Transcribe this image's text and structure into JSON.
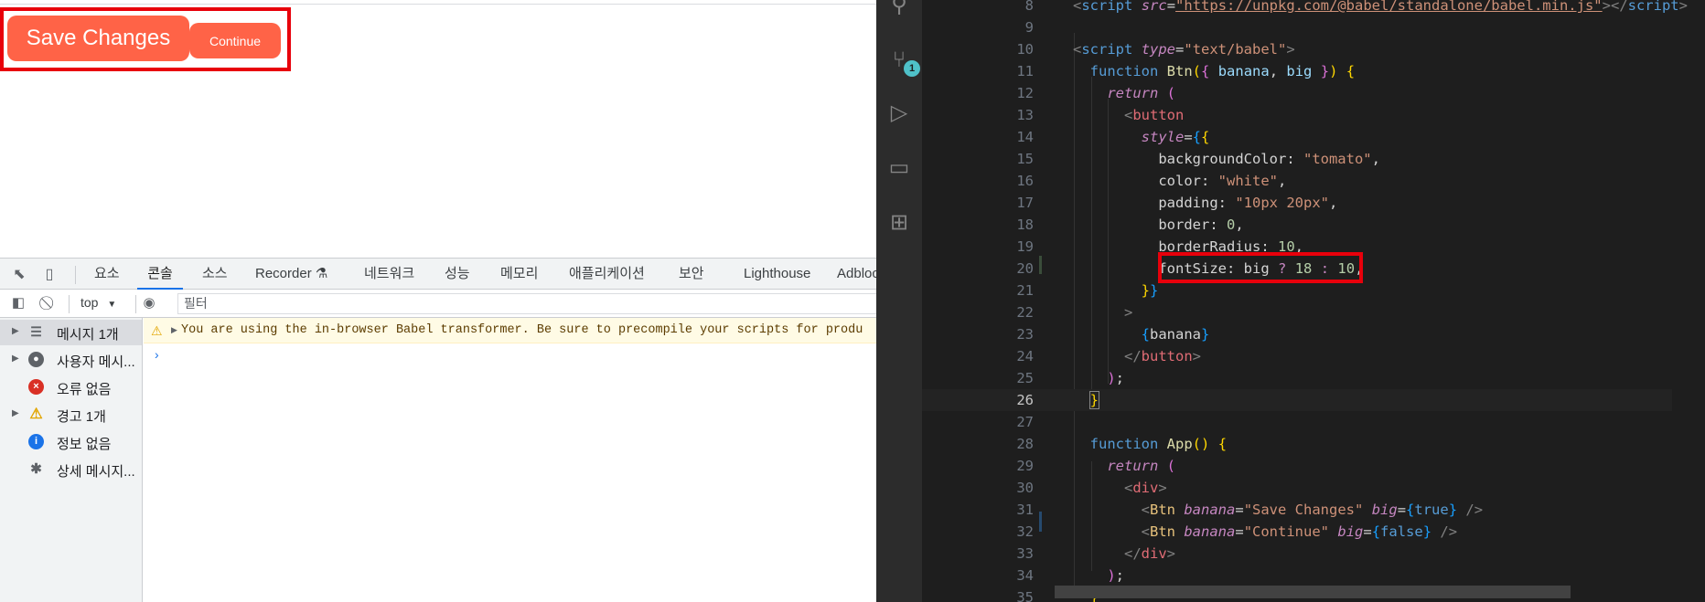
{
  "preview": {
    "buttons": [
      {
        "label": "Save Changes",
        "big": true
      },
      {
        "label": "Continue",
        "big": false
      }
    ],
    "colors": {
      "button_bg": "tomato",
      "highlight": "#e8000b"
    }
  },
  "devtools": {
    "tabs": [
      {
        "label": "요소"
      },
      {
        "label": "콘솔",
        "active": true
      },
      {
        "label": "소스"
      },
      {
        "label": "Recorder ⚗"
      },
      {
        "label": "네트워크"
      },
      {
        "label": "성능"
      },
      {
        "label": "메모리"
      },
      {
        "label": "애플리케이션"
      },
      {
        "label": "보안"
      },
      {
        "label": "Lighthouse"
      },
      {
        "label": "Adblock"
      }
    ],
    "toolbar": {
      "context": "top",
      "context_arrow": "▼",
      "filter_placeholder": "필터"
    },
    "sidebar": [
      {
        "label": "메시지 1개",
        "icon": "list-icon",
        "expandable": true,
        "selected": true
      },
      {
        "label": "사용자 메시...",
        "icon": "user-icon",
        "expandable": true
      },
      {
        "label": "오류 없음",
        "icon": "error-icon",
        "expandable": false
      },
      {
        "label": "경고 1개",
        "icon": "warning-icon",
        "expandable": true
      },
      {
        "label": "정보 없음",
        "icon": "info-icon",
        "expandable": false
      },
      {
        "label": "상세 메시지...",
        "icon": "bug-icon",
        "expandable": false
      }
    ],
    "console": {
      "warning": "You are using the in-browser Babel transformer. Be sure to precompile your scripts for produ",
      "prompt": "›"
    }
  },
  "editor": {
    "scm_badge": "1",
    "current_line": 26,
    "line_numbers": [
      "8",
      "9",
      "10",
      "11",
      "12",
      "13",
      "14",
      "15",
      "16",
      "17",
      "18",
      "19",
      "20",
      "21",
      "22",
      "23",
      "24",
      "25",
      "26",
      "27",
      "28",
      "29",
      "30",
      "31",
      "32",
      "33",
      "34",
      "35"
    ]
  }
}
